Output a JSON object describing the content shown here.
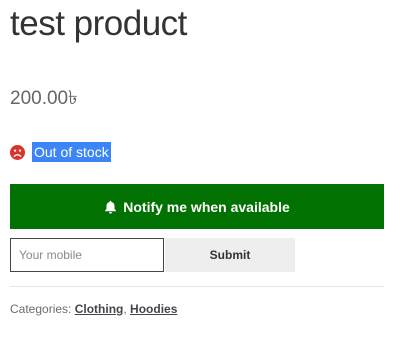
{
  "product": {
    "title": "test product",
    "price": "200.00৳",
    "stock_status": "Out of stock",
    "stock_icon_color": "#d9342b"
  },
  "notify": {
    "button_label": "Notify me when available",
    "button_color": "#017101",
    "icon": "bell-icon",
    "mobile_placeholder": "Your mobile",
    "mobile_value": "",
    "submit_label": "Submit"
  },
  "meta": {
    "categories_label": "Categories:",
    "categories": [
      "Clothing",
      "Hoodies"
    ],
    "separator": ", "
  }
}
